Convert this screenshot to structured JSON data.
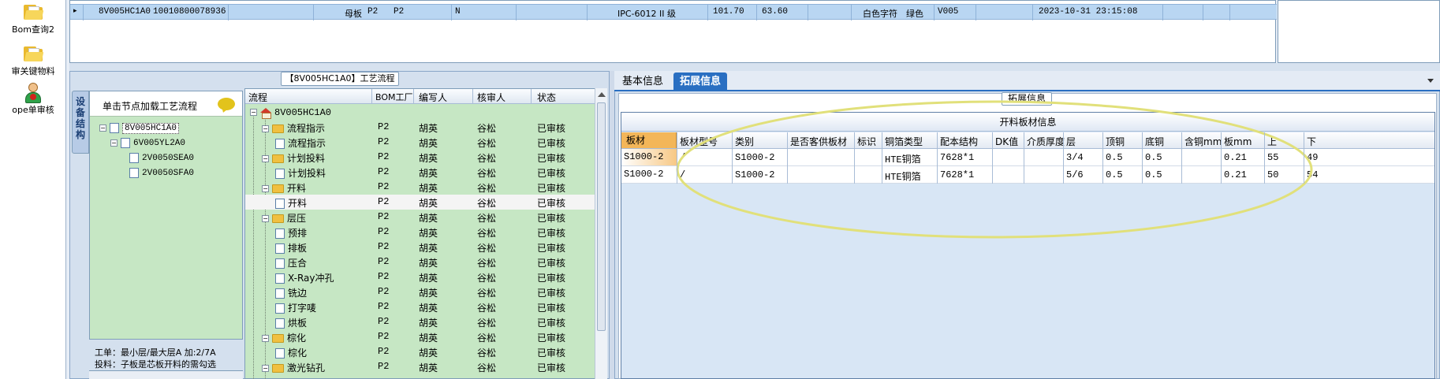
{
  "launcher": {
    "items": [
      {
        "label": "Bom查询2",
        "icon": "folder-icon"
      },
      {
        "label": "审关键物料",
        "icon": "folder-icon"
      },
      {
        "label": "ope单审核",
        "icon": "user-review-icon"
      }
    ]
  },
  "top_grid": {
    "row": [
      "8V005HC1A0",
      "10010800078936",
      "母板",
      "P2",
      "P2",
      "N",
      "IPC-6012 II 级",
      "101.70",
      "63.60",
      "白色字符",
      "绿色",
      "V005",
      "2023-10-31 23:15:08"
    ]
  },
  "left_panel": {
    "title": "【8V005HC1A0】工艺流程",
    "vertical_tab": "设备结构",
    "tree_hint": "单击节点加载工艺流程",
    "tree": [
      {
        "label": "8V005HC1A0",
        "toggle": "−"
      },
      {
        "label": "6V005YL2A0",
        "toggle": "−"
      },
      {
        "label": "2V0050SEA0"
      },
      {
        "label": "2V0050SFA0"
      }
    ],
    "status_line1": "工单：最小层/最大层A 加:2/7A",
    "status_line2": "投料：子板是芯板开料的需勾选"
  },
  "process_grid": {
    "columns": [
      "流程",
      "BOM工厂",
      "编写人",
      "核审人",
      "状态"
    ],
    "rows": [
      {
        "name": "8V005HC1A0",
        "factory": "",
        "writer": "",
        "reviewer": "",
        "status": "",
        "level": 0,
        "kind": "home"
      },
      {
        "name": "流程指示",
        "factory": "P2",
        "writer": "胡英",
        "reviewer": "谷松",
        "status": "已审核",
        "level": 1,
        "kind": "folder"
      },
      {
        "name": "流程指示",
        "factory": "P2",
        "writer": "胡英",
        "reviewer": "谷松",
        "status": "已审核",
        "level": 2,
        "kind": "doc"
      },
      {
        "name": "计划投料",
        "factory": "P2",
        "writer": "胡英",
        "reviewer": "谷松",
        "status": "已审核",
        "level": 1,
        "kind": "folder"
      },
      {
        "name": "计划投料",
        "factory": "P2",
        "writer": "胡英",
        "reviewer": "谷松",
        "status": "已审核",
        "level": 2,
        "kind": "doc"
      },
      {
        "name": "开料",
        "factory": "P2",
        "writer": "胡英",
        "reviewer": "谷松",
        "status": "已审核",
        "level": 1,
        "kind": "folder"
      },
      {
        "name": "开料",
        "factory": "P2",
        "writer": "胡英",
        "reviewer": "谷松",
        "status": "已审核",
        "level": 2,
        "kind": "doc",
        "highlight": true
      },
      {
        "name": "层压",
        "factory": "P2",
        "writer": "胡英",
        "reviewer": "谷松",
        "status": "已审核",
        "level": 1,
        "kind": "folder"
      },
      {
        "name": "预排",
        "factory": "P2",
        "writer": "胡英",
        "reviewer": "谷松",
        "status": "已审核",
        "level": 2,
        "kind": "doc"
      },
      {
        "name": "排板",
        "factory": "P2",
        "writer": "胡英",
        "reviewer": "谷松",
        "status": "已审核",
        "level": 2,
        "kind": "doc"
      },
      {
        "name": "压合",
        "factory": "P2",
        "writer": "胡英",
        "reviewer": "谷松",
        "status": "已审核",
        "level": 2,
        "kind": "doc"
      },
      {
        "name": "X-Ray冲孔",
        "factory": "P2",
        "writer": "胡英",
        "reviewer": "谷松",
        "status": "已审核",
        "level": 2,
        "kind": "doc"
      },
      {
        "name": "铣边",
        "factory": "P2",
        "writer": "胡英",
        "reviewer": "谷松",
        "status": "已审核",
        "level": 2,
        "kind": "doc"
      },
      {
        "name": "打字唛",
        "factory": "P2",
        "writer": "胡英",
        "reviewer": "谷松",
        "status": "已审核",
        "level": 2,
        "kind": "doc"
      },
      {
        "name": "烘板",
        "factory": "P2",
        "writer": "胡英",
        "reviewer": "谷松",
        "status": "已审核",
        "level": 2,
        "kind": "doc"
      },
      {
        "name": "棕化",
        "factory": "P2",
        "writer": "胡英",
        "reviewer": "谷松",
        "status": "已审核",
        "level": 1,
        "kind": "folder"
      },
      {
        "name": "棕化",
        "factory": "P2",
        "writer": "胡英",
        "reviewer": "谷松",
        "status": "已审核",
        "level": 2,
        "kind": "doc"
      },
      {
        "name": "激光钻孔",
        "factory": "P2",
        "writer": "胡英",
        "reviewer": "谷松",
        "status": "已审核",
        "level": 1,
        "kind": "folder"
      }
    ]
  },
  "right_panel": {
    "tabs": [
      "基本信息",
      "拓展信息"
    ],
    "active_tab": 1,
    "group_title": "拓展信息",
    "material_table": {
      "title": "开料板材信息",
      "columns": [
        "板材",
        "板材型号",
        "类别",
        "是否客供板材",
        "标识",
        "铜箔类型",
        "配本结构",
        "DK值",
        "介质厚度",
        "层",
        "顶铜",
        "底铜",
        "含铜mm",
        "板mm",
        "上",
        "下"
      ],
      "rows": [
        [
          "S1000-2",
          "/",
          "S1000-2",
          "",
          "",
          "HTE铜箔",
          "7628*1",
          "",
          "",
          "3/4",
          "0.5",
          "0.5",
          "",
          "0.21",
          "55",
          "49"
        ],
        [
          "S1000-2",
          "/",
          "S1000-2",
          "",
          "",
          "HTE铜箔",
          "7628*1",
          "",
          "",
          "5/6",
          "0.5",
          "0.5",
          "",
          "0.21",
          "50",
          "54"
        ]
      ]
    }
  },
  "colors": {
    "accent": "#2a6fc2",
    "tree_bg": "#c6e7c4",
    "header_first": "#f3b659",
    "annotation": "#e1e07a"
  }
}
